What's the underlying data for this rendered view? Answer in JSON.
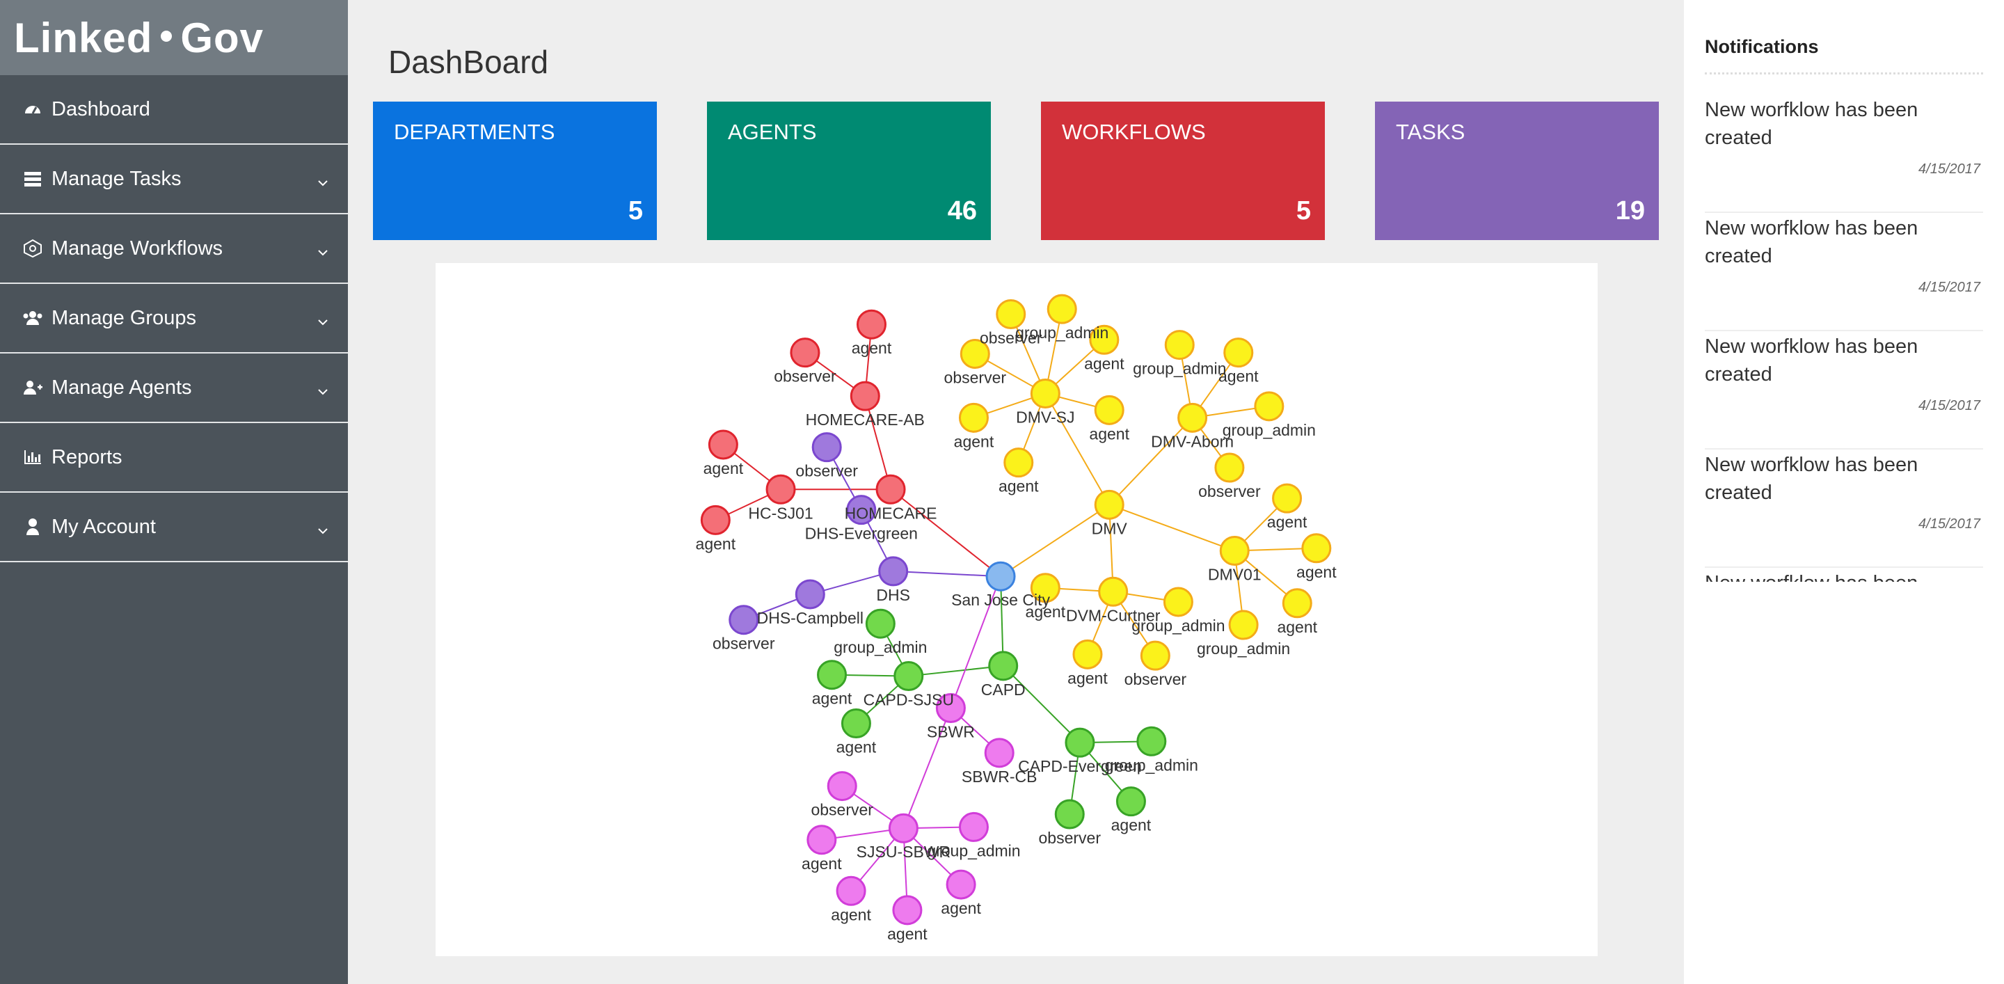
{
  "app": {
    "brand_left": "Linked",
    "brand_right": "Gov"
  },
  "nav": [
    {
      "label": "Dashboard",
      "icon": "dashboard-icon",
      "chevron": false
    },
    {
      "label": "Manage Tasks",
      "icon": "tasks-icon",
      "chevron": true
    },
    {
      "label": "Manage Workflows",
      "icon": "workflow-icon",
      "chevron": true
    },
    {
      "label": "Manage Groups",
      "icon": "users-icon",
      "chevron": true
    },
    {
      "label": "Manage Agents",
      "icon": "user-plus-icon",
      "chevron": true
    },
    {
      "label": "Reports",
      "icon": "bar-chart-icon",
      "chevron": false
    },
    {
      "label": "My Account",
      "icon": "user-icon",
      "chevron": true
    }
  ],
  "page": {
    "title": "DashBoard"
  },
  "stats": [
    {
      "label": "DEPARTMENTS",
      "count": "5",
      "color": "#0a73df"
    },
    {
      "label": "AGENTS",
      "count": "46",
      "color": "#008a72"
    },
    {
      "label": "WORKFLOWS",
      "count": "5",
      "color": "#d2313a"
    },
    {
      "label": "TASKS",
      "count": "19",
      "color": "#8464b6"
    }
  ],
  "notifications": {
    "title": "Notifications",
    "items": [
      {
        "message": "New worfklow has been created",
        "date": "4/15/2017"
      },
      {
        "message": "New worfklow has been created",
        "date": "4/15/2017"
      },
      {
        "message": "New worfklow has been created",
        "date": "4/15/2017"
      },
      {
        "message": "New worfklow has been created",
        "date": "4/15/2017"
      },
      {
        "message": "New worfklow has been created",
        "date": ""
      }
    ]
  },
  "graph": {
    "colors": {
      "red": {
        "fill": "#f46f77",
        "stroke": "#e0242e"
      },
      "purple": {
        "fill": "#9f79dd",
        "stroke": "#7b47cf"
      },
      "yellow": {
        "fill": "#fbf21b",
        "stroke": "#f4ab18"
      },
      "green": {
        "fill": "#72d94b",
        "stroke": "#38a326"
      },
      "magenta": {
        "fill": "#ee7bee",
        "stroke": "#d13dd9"
      },
      "blue": {
        "fill": "#89b9ef",
        "stroke": "#3b82df"
      }
    },
    "nodes": [
      {
        "id": "sjc",
        "label": "San Jose City",
        "g": "blue"
      },
      {
        "id": "homecare",
        "label": "HOMECARE",
        "g": "red"
      },
      {
        "id": "homecare_ab",
        "label": "HOMECARE-AB",
        "g": "red"
      },
      {
        "id": "hc_agent1",
        "label": "agent",
        "g": "red"
      },
      {
        "id": "hc_observer1",
        "label": "observer",
        "g": "red"
      },
      {
        "id": "hcsj01",
        "label": "HC-SJ01",
        "g": "red"
      },
      {
        "id": "hc_agent2",
        "label": "agent",
        "g": "red"
      },
      {
        "id": "hc_agent3",
        "label": "agent",
        "g": "red"
      },
      {
        "id": "dhs",
        "label": "DHS",
        "g": "purple"
      },
      {
        "id": "dhs_evergreen",
        "label": "DHS-Evergreen",
        "g": "purple"
      },
      {
        "id": "dhs_observer1",
        "label": "observer",
        "g": "purple"
      },
      {
        "id": "dhs_campbell",
        "label": "DHS-Campbell",
        "g": "purple"
      },
      {
        "id": "dhs_observer2",
        "label": "observer",
        "g": "purple"
      },
      {
        "id": "dmv",
        "label": "DMV",
        "g": "yellow"
      },
      {
        "id": "dmv_sj",
        "label": "DMV-SJ",
        "g": "yellow"
      },
      {
        "id": "dmvsj_observer1",
        "label": "observer",
        "g": "yellow"
      },
      {
        "id": "dmvsj_ga",
        "label": "group_admin",
        "g": "yellow"
      },
      {
        "id": "dmvsj_agent1",
        "label": "agent",
        "g": "yellow"
      },
      {
        "id": "dmvsj_observer2",
        "label": "observer",
        "g": "yellow"
      },
      {
        "id": "dmvsj_agent2",
        "label": "agent",
        "g": "yellow"
      },
      {
        "id": "dmvsj_agent3",
        "label": "agent",
        "g": "yellow"
      },
      {
        "id": "dmvsj_agent4",
        "label": "agent",
        "g": "yellow"
      },
      {
        "id": "dmv_aborn",
        "label": "DMV-Aborn",
        "g": "yellow"
      },
      {
        "id": "aborn_ga1",
        "label": "group_admin",
        "g": "yellow"
      },
      {
        "id": "aborn_agent",
        "label": "agent",
        "g": "yellow"
      },
      {
        "id": "aborn_ga2",
        "label": "group_admin",
        "g": "yellow"
      },
      {
        "id": "aborn_observer",
        "label": "observer",
        "g": "yellow"
      },
      {
        "id": "dmv01",
        "label": "DMV01",
        "g": "yellow"
      },
      {
        "id": "dmv01_agent1",
        "label": "agent",
        "g": "yellow"
      },
      {
        "id": "dmv01_agent2",
        "label": "agent",
        "g": "yellow"
      },
      {
        "id": "dmv01_agent3",
        "label": "agent",
        "g": "yellow"
      },
      {
        "id": "dmv01_ga",
        "label": "group_admin",
        "g": "yellow"
      },
      {
        "id": "dvm_curtner",
        "label": "DVM-Curtner",
        "g": "yellow"
      },
      {
        "id": "curt_agent1",
        "label": "agent",
        "g": "yellow"
      },
      {
        "id": "curt_ga",
        "label": "group_admin",
        "g": "yellow"
      },
      {
        "id": "curt_agent2",
        "label": "agent",
        "g": "yellow"
      },
      {
        "id": "curt_observer",
        "label": "observer",
        "g": "yellow"
      },
      {
        "id": "capd",
        "label": "CAPD",
        "g": "green"
      },
      {
        "id": "capd_sjsu",
        "label": "CAPD-SJSU",
        "g": "green"
      },
      {
        "id": "capdsjsu_ga",
        "label": "group_admin",
        "g": "green"
      },
      {
        "id": "capdsjsu_agent1",
        "label": "agent",
        "g": "green"
      },
      {
        "id": "capdsjsu_agent2",
        "label": "agent",
        "g": "green"
      },
      {
        "id": "capd_evergreen",
        "label": "CAPD-Evergreen",
        "g": "green"
      },
      {
        "id": "capdev_ga",
        "label": "group_admin",
        "g": "green"
      },
      {
        "id": "capdev_agent",
        "label": "agent",
        "g": "green"
      },
      {
        "id": "capdev_observer",
        "label": "observer",
        "g": "green"
      },
      {
        "id": "sbwr",
        "label": "SBWR",
        "g": "magenta"
      },
      {
        "id": "sbwr_cb",
        "label": "SBWR-CB",
        "g": "magenta"
      },
      {
        "id": "sjsu_sbwr",
        "label": "SJSU-SBWR",
        "g": "magenta"
      },
      {
        "id": "sbwr_observer",
        "label": "observer",
        "g": "magenta"
      },
      {
        "id": "sbwr_ga",
        "label": "group_admin",
        "g": "magenta"
      },
      {
        "id": "sbwr_agent1",
        "label": "agent",
        "g": "magenta"
      },
      {
        "id": "sbwr_agent2",
        "label": "agent",
        "g": "magenta"
      },
      {
        "id": "sbwr_agent3",
        "label": "agent",
        "g": "magenta"
      },
      {
        "id": "sbwr_agent4",
        "label": "agent",
        "g": "magenta"
      }
    ],
    "edges": [
      [
        "sjc",
        "homecare",
        "red"
      ],
      [
        "homecare",
        "homecare_ab",
        "red"
      ],
      [
        "homecare_ab",
        "hc_agent1",
        "red"
      ],
      [
        "homecare_ab",
        "hc_observer1",
        "red"
      ],
      [
        "homecare",
        "hcsj01",
        "red"
      ],
      [
        "hcsj01",
        "hc_agent2",
        "red"
      ],
      [
        "hcsj01",
        "hc_agent3",
        "red"
      ],
      [
        "sjc",
        "dhs",
        "purple"
      ],
      [
        "dhs",
        "dhs_evergreen",
        "purple"
      ],
      [
        "dhs_evergreen",
        "dhs_observer1",
        "purple"
      ],
      [
        "dhs",
        "dhs_campbell",
        "purple"
      ],
      [
        "dhs_campbell",
        "dhs_observer2",
        "purple"
      ],
      [
        "sjc",
        "dmv",
        "yellow"
      ],
      [
        "dmv",
        "dmv_sj",
        "yellow"
      ],
      [
        "dmv_sj",
        "dmvsj_observer1",
        "yellow"
      ],
      [
        "dmv_sj",
        "dmvsj_ga",
        "yellow"
      ],
      [
        "dmv_sj",
        "dmvsj_agent1",
        "yellow"
      ],
      [
        "dmv_sj",
        "dmvsj_observer2",
        "yellow"
      ],
      [
        "dmv_sj",
        "dmvsj_agent2",
        "yellow"
      ],
      [
        "dmv_sj",
        "dmvsj_agent3",
        "yellow"
      ],
      [
        "dmv_sj",
        "dmvsj_agent4",
        "yellow"
      ],
      [
        "dmv",
        "dmv_aborn",
        "yellow"
      ],
      [
        "dmv_aborn",
        "aborn_ga1",
        "yellow"
      ],
      [
        "dmv_aborn",
        "aborn_agent",
        "yellow"
      ],
      [
        "dmv_aborn",
        "aborn_ga2",
        "yellow"
      ],
      [
        "dmv_aborn",
        "aborn_observer",
        "yellow"
      ],
      [
        "dmv",
        "dmv01",
        "yellow"
      ],
      [
        "dmv01",
        "dmv01_agent1",
        "yellow"
      ],
      [
        "dmv01",
        "dmv01_agent2",
        "yellow"
      ],
      [
        "dmv01",
        "dmv01_agent3",
        "yellow"
      ],
      [
        "dmv01",
        "dmv01_ga",
        "yellow"
      ],
      [
        "dmv",
        "dvm_curtner",
        "yellow"
      ],
      [
        "dvm_curtner",
        "curt_agent1",
        "yellow"
      ],
      [
        "dvm_curtner",
        "curt_ga",
        "yellow"
      ],
      [
        "dvm_curtner",
        "curt_agent2",
        "yellow"
      ],
      [
        "dvm_curtner",
        "curt_observer",
        "yellow"
      ],
      [
        "sjc",
        "capd",
        "green"
      ],
      [
        "capd",
        "capd_sjsu",
        "green"
      ],
      [
        "capd_sjsu",
        "capdsjsu_ga",
        "green"
      ],
      [
        "capd_sjsu",
        "capdsjsu_agent1",
        "green"
      ],
      [
        "capd_sjsu",
        "capdsjsu_agent2",
        "green"
      ],
      [
        "capd",
        "capd_evergreen",
        "green"
      ],
      [
        "capd_evergreen",
        "capdev_ga",
        "green"
      ],
      [
        "capd_evergreen",
        "capdev_agent",
        "green"
      ],
      [
        "capd_evergreen",
        "capdev_observer",
        "green"
      ],
      [
        "sjc",
        "sbwr",
        "magenta"
      ],
      [
        "sbwr",
        "sbwr_cb",
        "magenta"
      ],
      [
        "sbwr",
        "sjsu_sbwr",
        "magenta"
      ],
      [
        "sjsu_sbwr",
        "sbwr_observer",
        "magenta"
      ],
      [
        "sjsu_sbwr",
        "sbwr_ga",
        "magenta"
      ],
      [
        "sjsu_sbwr",
        "sbwr_agent1",
        "magenta"
      ],
      [
        "sjsu_sbwr",
        "sbwr_agent2",
        "magenta"
      ],
      [
        "sjsu_sbwr",
        "sbwr_agent3",
        "magenta"
      ],
      [
        "sjsu_sbwr",
        "sbwr_agent4",
        "magenta"
      ]
    ]
  }
}
